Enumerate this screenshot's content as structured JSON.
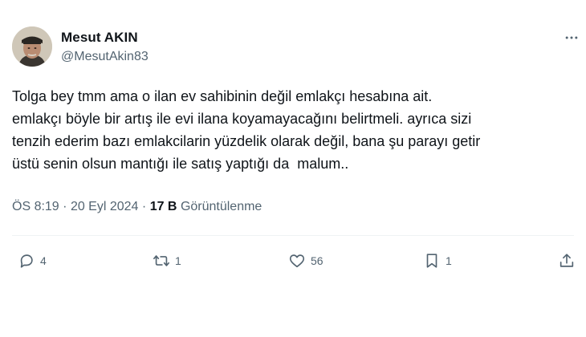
{
  "author": {
    "display_name": "Mesut AKIN",
    "handle": "@MesutAkin83"
  },
  "tweet_text_lines": [
    "Tolga bey tmm ama o ilan ev sahibinin değil emlakçı hesabına ait.",
    "emlakçı böyle bir artış ile evi ilana koyamayacağını belirtmeli. ayrıca sizi",
    "tenzih ederim bazı emlakcilarin yüzdelik olarak değil, bana şu parayı getir",
    "üstü senin olsun mantığı ile satış yaptığı da  malum.."
  ],
  "meta": {
    "time": "ÖS 8:19",
    "separator": "·",
    "date": "20 Eyl 2024",
    "views_count": "17 B",
    "views_label": "Görüntülenme"
  },
  "actions": {
    "reply_count": "4",
    "retweet_count": "1",
    "like_count": "56",
    "bookmark_count": "1"
  },
  "icons": {
    "more": "more-horizontal-icon",
    "reply": "reply-icon",
    "retweet": "retweet-icon",
    "like": "heart-icon",
    "bookmark": "bookmark-icon",
    "share": "share-icon"
  },
  "colors": {
    "text_primary": "#0f1419",
    "text_secondary": "#536471",
    "divider": "#eff3f4"
  }
}
